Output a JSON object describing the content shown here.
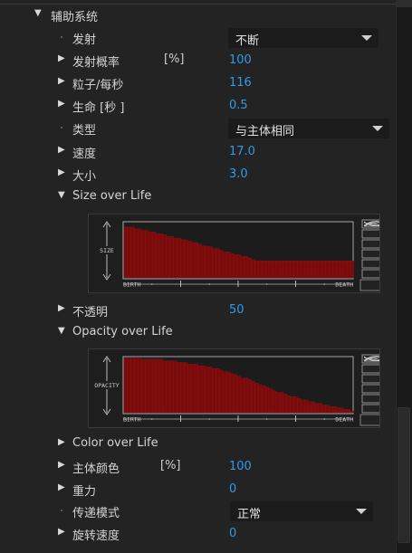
{
  "section": {
    "title": "辅助系统"
  },
  "props": {
    "emit": {
      "label": "发射",
      "value": "不断"
    },
    "emit_prob": {
      "label": "发射概率",
      "unit": "[%]",
      "value": "100"
    },
    "particles": {
      "label": "粒子/每秒",
      "value": "116"
    },
    "life": {
      "label": "生命 [秒 ]",
      "value": "0.5"
    },
    "type": {
      "label": "类型",
      "value": "与主体相同"
    },
    "speed": {
      "label": "速度",
      "value": "17.0"
    },
    "size": {
      "label": "大小",
      "value": "3.0"
    },
    "size_over_life": {
      "label": "Size over Life"
    },
    "opacity": {
      "label": "不透明",
      "value": "50"
    },
    "opacity_over_life": {
      "label": "Opacity over Life"
    },
    "color_over_life": {
      "label": "Color over Life"
    },
    "main_color": {
      "label": "主体颜色",
      "unit": "[%]",
      "value": "100"
    },
    "gravity": {
      "label": "重力",
      "value": "0"
    },
    "transfer": {
      "label": "传递模式",
      "value": "正常"
    },
    "rot_speed": {
      "label": "旋转速度",
      "value": "0"
    }
  },
  "graphs": {
    "size": {
      "ylabel": "SIZE",
      "birth": "BIRTH",
      "death": "DEATH",
      "values": [
        0.92,
        0.92,
        0.92,
        0.89,
        0.89,
        0.86,
        0.86,
        0.83,
        0.83,
        0.8,
        0.8,
        0.78,
        0.75,
        0.75,
        0.72,
        0.72,
        0.69,
        0.69,
        0.67,
        0.64,
        0.64,
        0.61,
        0.58,
        0.58,
        0.56,
        0.53,
        0.53,
        0.5,
        0.47,
        0.47,
        0.44,
        0.42,
        0.42,
        0.39,
        0.39,
        0.36,
        0.33,
        0.31,
        0.31,
        0.31,
        0.31,
        0.31,
        0.31,
        0.31,
        0.31,
        0.31,
        0.31,
        0.31,
        0.31,
        0.31,
        0.31,
        0.31,
        0.31,
        0.31,
        0.31,
        0.31,
        0.31,
        0.31,
        0.31,
        0.31,
        0.31,
        0.31,
        0.31,
        0.31,
        0.31
      ]
    },
    "opacity": {
      "ylabel": "OPACITY",
      "birth": "BIRTH",
      "death": "DEATH",
      "values": [
        0.99,
        0.99,
        0.99,
        0.99,
        0.99,
        0.97,
        0.97,
        0.97,
        0.97,
        0.97,
        0.97,
        0.94,
        0.94,
        0.94,
        0.94,
        0.91,
        0.91,
        0.91,
        0.88,
        0.88,
        0.88,
        0.85,
        0.85,
        0.83,
        0.83,
        0.8,
        0.8,
        0.77,
        0.74,
        0.74,
        0.71,
        0.69,
        0.66,
        0.63,
        0.63,
        0.6,
        0.57,
        0.54,
        0.51,
        0.49,
        0.46,
        0.43,
        0.4,
        0.37,
        0.37,
        0.34,
        0.31,
        0.29,
        0.29,
        0.26,
        0.23,
        0.23,
        0.2,
        0.2,
        0.17,
        0.17,
        0.14,
        0.14,
        0.11,
        0.11,
        0.09,
        0.09,
        0.06,
        0.06,
        0.03
      ]
    }
  },
  "colors": {
    "accent": "#2e9bea",
    "bar": "#7a0b0b",
    "bar_edge": "#9a1414"
  }
}
